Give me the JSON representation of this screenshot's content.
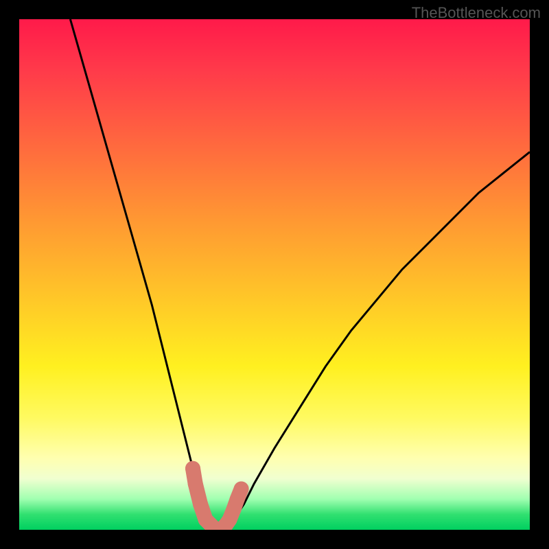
{
  "watermark": "TheBottleneck.com",
  "chart_data": {
    "type": "line",
    "title": "",
    "xlabel": "",
    "ylabel": "",
    "xlim": [
      0,
      100
    ],
    "ylim": [
      0,
      100
    ],
    "series": [
      {
        "name": "bottleneck-curve",
        "x": [
          10,
          14,
          18,
          22,
          26,
          30,
          32,
          34,
          35.5,
          37,
          38,
          39,
          40,
          42,
          44,
          46,
          50,
          55,
          60,
          65,
          70,
          75,
          80,
          85,
          90,
          95,
          100
        ],
        "y": [
          100,
          86,
          72,
          58,
          44,
          28,
          20,
          12,
          6,
          2,
          0,
          0,
          0,
          2,
          5,
          9,
          16,
          24,
          32,
          39,
          45,
          51,
          56,
          61,
          66,
          70,
          74
        ]
      },
      {
        "name": "highlight-points",
        "type": "scatter",
        "x": [
          34.0,
          34.5,
          35.5,
          36.5,
          37.5,
          38.5,
          39.5,
          40.5,
          41.2,
          42.0,
          42.7,
          43.5
        ],
        "y": [
          12,
          9,
          5,
          2,
          1,
          0,
          0,
          1,
          2,
          4,
          6,
          8
        ],
        "color": "#d87a6e"
      }
    ]
  }
}
